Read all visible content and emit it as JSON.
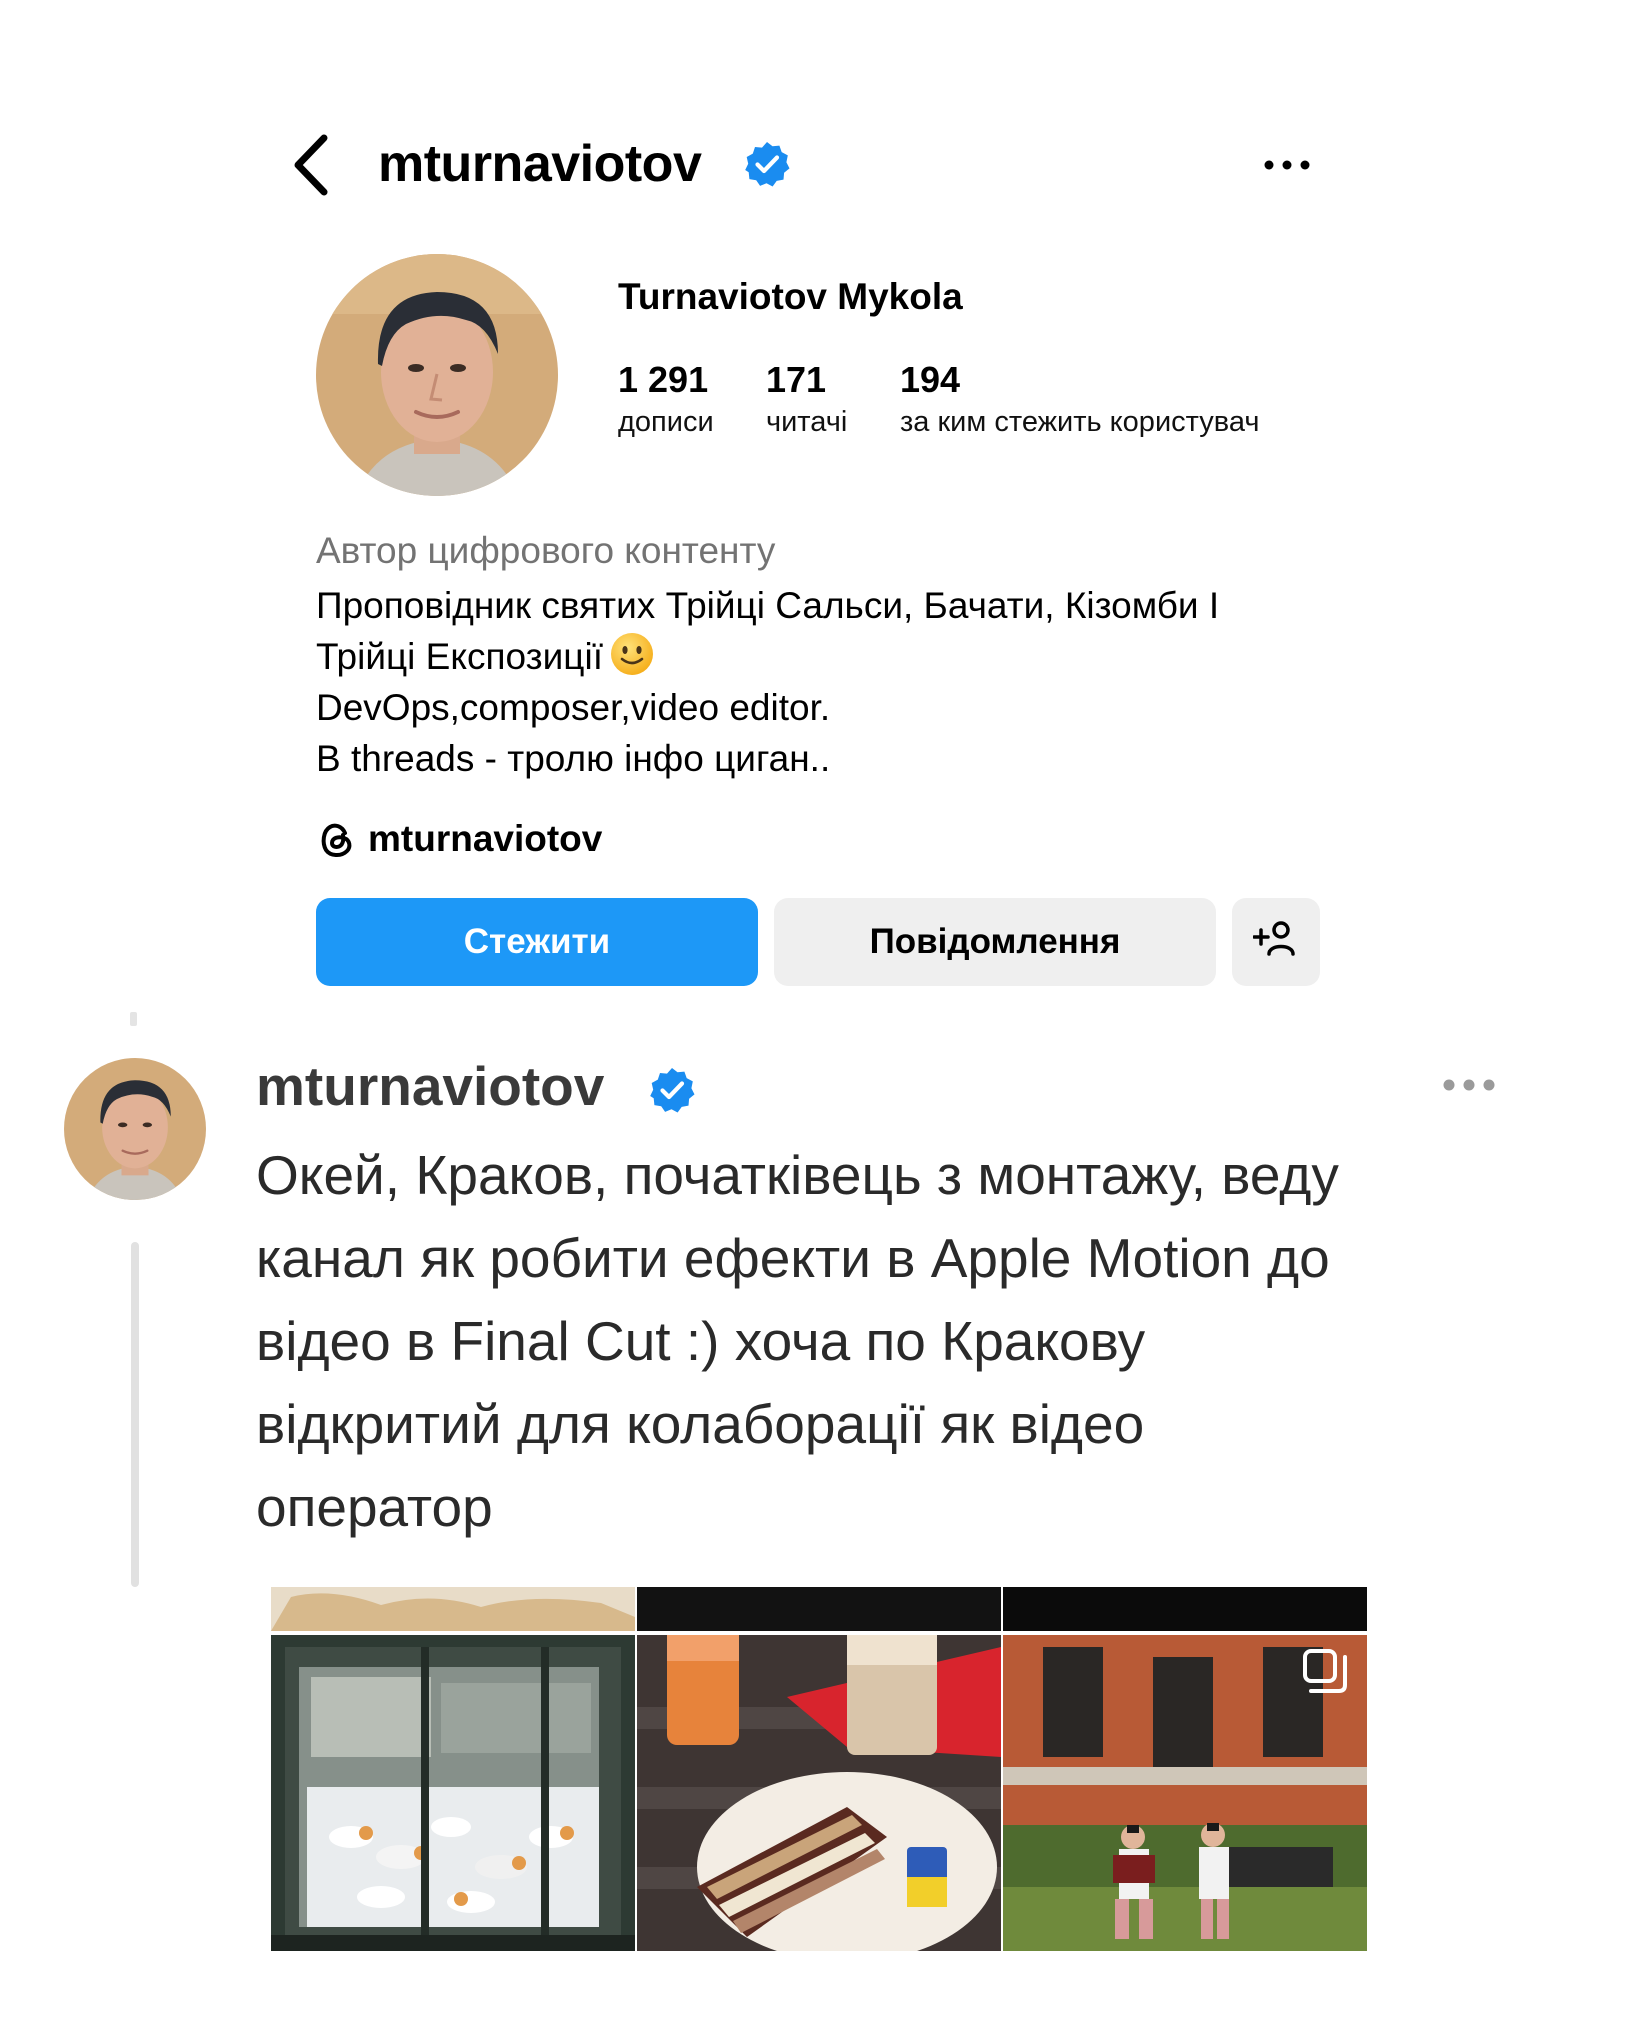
{
  "header": {
    "username": "mturnaviotov",
    "icons": {
      "back": "chevron-left-icon",
      "verified": "verified-badge-icon",
      "more": "more-horizontal-icon"
    }
  },
  "profile": {
    "display_name": "Turnaviotov Mykola",
    "stats": [
      {
        "value": "1 291",
        "label": "дописи"
      },
      {
        "value": "171",
        "label": "читачі"
      },
      {
        "value": "194",
        "label": "за ким стежить користувач"
      }
    ],
    "category": "Автор цифрового контенту",
    "bio_lines": [
      "Проповідник святих Трійці Сальси, Бачати, Кізомби І",
      "Трійці Експозиції",
      "DevOps,composer,video editor.",
      "В threads - тролю інфо циган.."
    ],
    "bio_emoji": "slightly-smiling-face",
    "threads_handle": "mturnaviotov"
  },
  "actions": {
    "follow_label": "Стежити",
    "message_label": "Повідомлення",
    "add_user_icon": "add-user-icon"
  },
  "colors": {
    "accent": "#1d98f7",
    "verified": "#1a8cf0",
    "secondary_button": "#efefef",
    "muted_text": "#737373"
  },
  "post": {
    "username": "mturnaviotov",
    "text_lines": [
      "Окей, Краков, початківець з монтажу, веду",
      "канал як робити ефекти в Apple Motion до",
      "відео в Final Cut :) хоча по Кракову",
      "відкритий для колаборації як відео",
      "оператор"
    ],
    "media": [
      {
        "name": "window-display-photo"
      },
      {
        "name": "cake-and-coffee-photo"
      },
      {
        "name": "street-musicians-photo",
        "badge": "multiple-images-icon"
      }
    ]
  }
}
